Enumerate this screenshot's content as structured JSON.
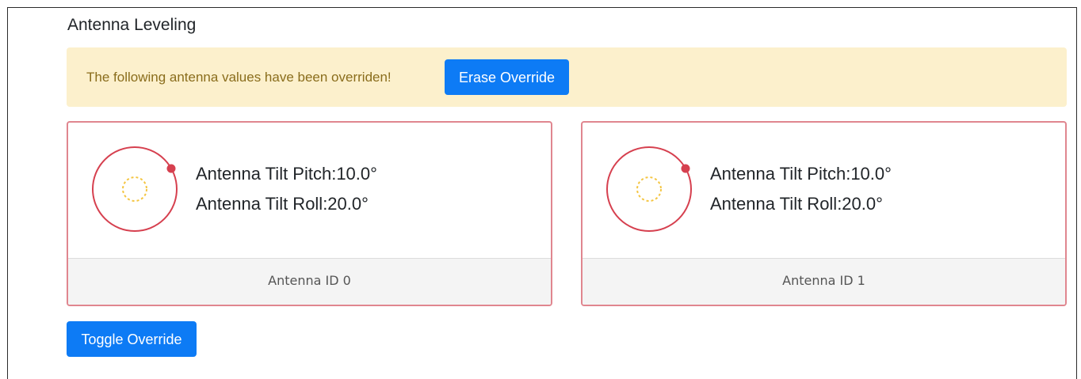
{
  "page": {
    "title": "Antenna Leveling"
  },
  "alert": {
    "message": "The following antenna values have been overriden!",
    "erase_button_label": "Erase Override"
  },
  "antennas": [
    {
      "pitch_label": "Antenna Tilt Pitch:10.0°",
      "roll_label": "Antenna Tilt Roll:20.0°",
      "footer": "Antenna ID 0"
    },
    {
      "pitch_label": "Antenna Tilt Pitch:10.0°",
      "roll_label": "Antenna Tilt Roll:20.0°",
      "footer": "Antenna ID 1"
    }
  ],
  "toggle_button_label": "Toggle Override",
  "colors": {
    "primary": "#0d7bf5",
    "alert_bg": "#fcf0cc",
    "alert_text": "#8a6d1c",
    "card_border": "#e0868f",
    "gauge_ring": "#d6404f",
    "gauge_center": "#f4c542"
  }
}
